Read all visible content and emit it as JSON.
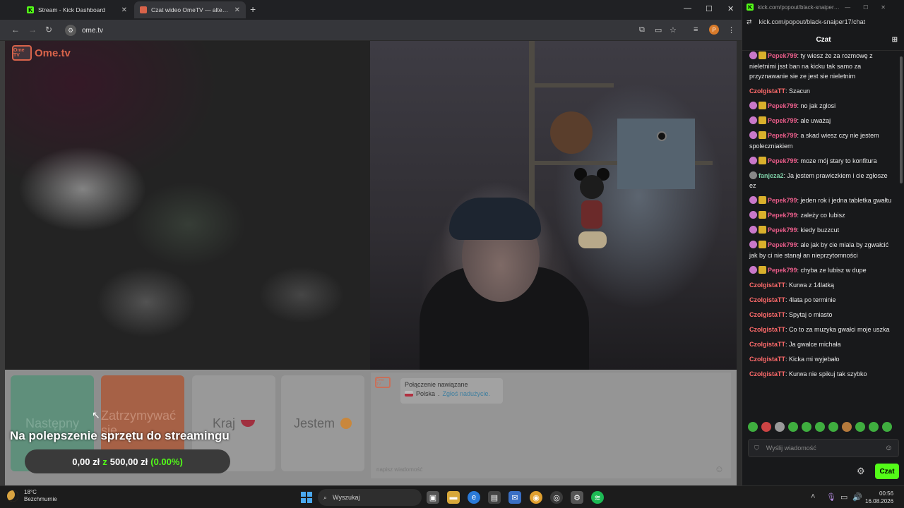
{
  "browser": {
    "tabs": [
      {
        "title": "Stream - Kick Dashboard",
        "favicon": "kick-icon"
      },
      {
        "title": "Czat wideo OmeTV — alte…",
        "favicon": "ometv-icon"
      }
    ],
    "url": "ome.tv"
  },
  "ometv": {
    "logo_small": "Ome TV",
    "logo_text": "Ome.tv",
    "buttons": {
      "next": "Następny",
      "stop": "Zatrzymywać się",
      "country": "Kraj",
      "gender": "Jestem"
    },
    "connection": {
      "status": "Połączenie nawiązane",
      "country": "Polska",
      "separator": ".",
      "report": "Zgłoś nadużycie."
    },
    "message_placeholder": "napisz wiadomość"
  },
  "overlay": {
    "title": "Na polepszenie sprzętu do streamingu",
    "goal_current": "0,00 zł",
    "goal_of": "z",
    "goal_target": "500,00 zł",
    "goal_percent": "(0.00%)",
    "goal_progress": 0
  },
  "popup": {
    "window_title": "kick.com/popout/black-snaiper…",
    "url": "kick.com/popout/black-snaiper17/chat",
    "chat_title": "Czat",
    "messages": [
      {
        "user": "Pepek799",
        "text": ": ty wiesz że za rozmowę z nieletnimi jsst ban na kicku tak samo za przyznawanie sie ze jest sie nieletnim"
      },
      {
        "user": "CzolgistaTT",
        "text": ": Szacun"
      },
      {
        "user": "Pepek799",
        "text": ": no jak zglosi"
      },
      {
        "user": "Pepek799",
        "text": ": ale uważaj"
      },
      {
        "user": "Pepek799",
        "text": ": a skad wiesz czy nie jestem spoleczniakiem"
      },
      {
        "user": "Pepek799",
        "text": ": moze mój stary to konfitura"
      },
      {
        "user": "fanjeza2",
        "text": ": Ja jestem prawiczkiem i cie zgłosze ez"
      },
      {
        "user": "Pepek799",
        "text": ": jeden rok i jedna tabletka gwałtu"
      },
      {
        "user": "Pepek799",
        "text": ": zależy co lubisz"
      },
      {
        "user": "Pepek799",
        "text": ": kiedy buzzcut"
      },
      {
        "user": "Pepek799",
        "text": ": ale jak by cie miala by zgwałcić jak by ci nie stanął an nieprzytomności"
      },
      {
        "user": "Pepek799",
        "text": ": chyba ze lubisz w dupe"
      },
      {
        "user": "CzolgistaTT",
        "text": ": Kurwa z 14latką"
      },
      {
        "user": "CzolgistaTT",
        "text": ": 4lata po terminie"
      },
      {
        "user": "CzolgistaTT",
        "text": ": Spytaj o miasto"
      },
      {
        "user": "CzolgistaTT",
        "text": ": Co to za muzyka gwałci moje uszka"
      },
      {
        "user": "CzolgistaTT",
        "text": ": Ja gwalce michała"
      },
      {
        "user": "CzolgistaTT",
        "text": ": Kicka mi wyjebało"
      },
      {
        "user": "CzolgistaTT",
        "text": ": Kurwa nie spikuj tak szybko"
      }
    ],
    "input_placeholder": "Wyślij wiadomość",
    "send_label": "Czat"
  },
  "taskbar": {
    "temperature": "18°C",
    "weather": "Bezchmurnie",
    "search_placeholder": "Wyszukaj",
    "time": "00:56",
    "date": "16.08.2026"
  },
  "colors": {
    "kick_green": "#53fc18",
    "ometv_orange": "#d8634a",
    "username_pink": "#ea5d8a"
  }
}
